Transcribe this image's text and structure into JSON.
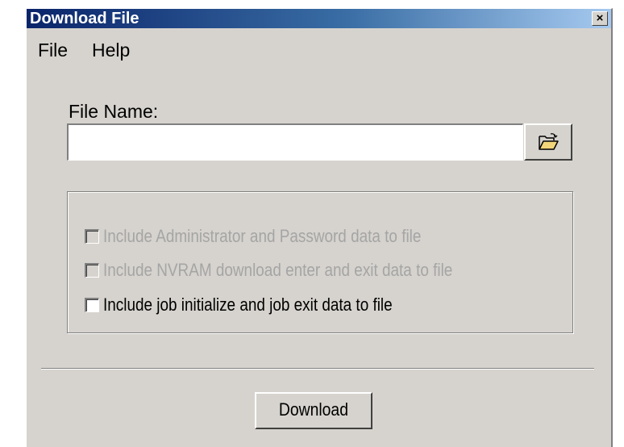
{
  "window": {
    "title": "Download File",
    "close_label": "×"
  },
  "menu": {
    "items": [
      {
        "label": "File"
      },
      {
        "label": "Help"
      }
    ]
  },
  "form": {
    "file_name_label": "File Name:",
    "file_name_value": "",
    "browse_icon": "folder-open-icon"
  },
  "options": [
    {
      "label": "Include Administrator and Password data to file",
      "checked": false,
      "enabled": false
    },
    {
      "label": "Include NVRAM download enter and exit data to file",
      "checked": false,
      "enabled": false
    },
    {
      "label": "Include job initialize and job exit data to file",
      "checked": false,
      "enabled": true
    }
  ],
  "actions": {
    "download_label": "Download"
  },
  "colors": {
    "title_gradient_start": "#0a246a",
    "title_gradient_end": "#a6caf0",
    "face": "#d6d3ce",
    "disabled_text": "#a5a5a5"
  }
}
